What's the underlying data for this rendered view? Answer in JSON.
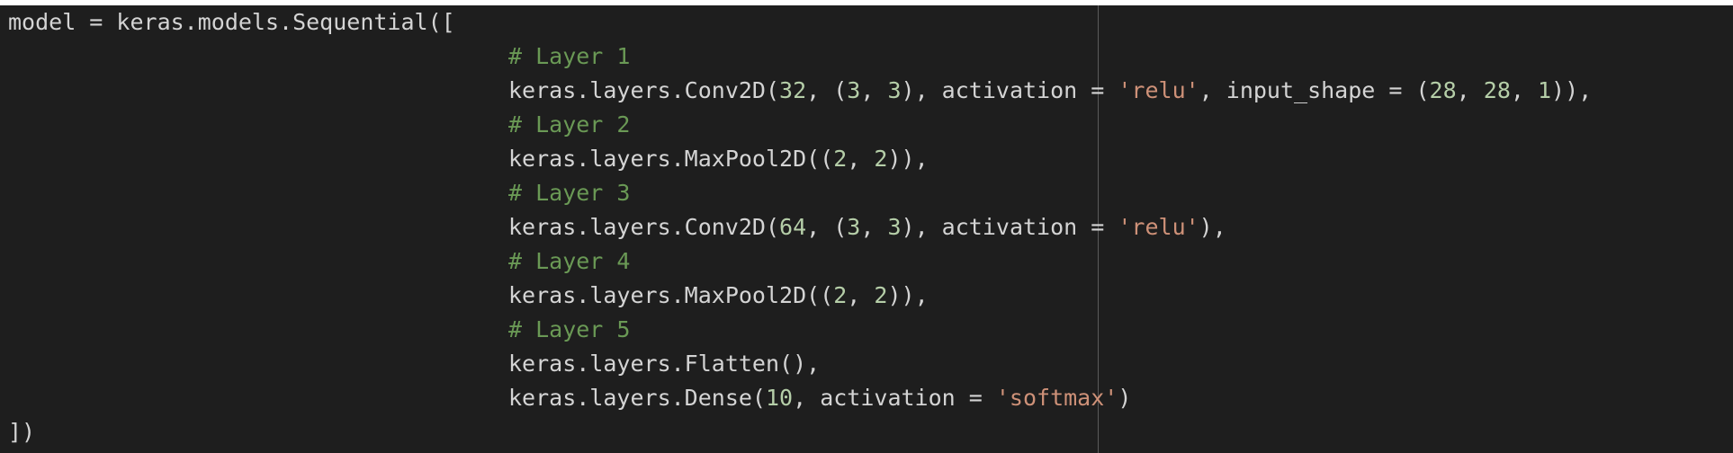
{
  "editor": {
    "colors": {
      "background": "#1e1e1e",
      "text": "#d4d4d4",
      "comment": "#6a9955",
      "string": "#ce9178",
      "number": "#b5cea8",
      "ruler": "#5a5a5a"
    },
    "lines": [
      {
        "tokens": [
          {
            "t": "plain",
            "v": "model = keras.models.Sequential(["
          }
        ]
      },
      {
        "tokens": [
          {
            "t": "comment",
            "v": "# Layer 1"
          }
        ]
      },
      {
        "tokens": [
          {
            "t": "plain",
            "v": "keras.layers.Conv2D("
          },
          {
            "t": "number",
            "v": "32"
          },
          {
            "t": "plain",
            "v": ", ("
          },
          {
            "t": "number",
            "v": "3"
          },
          {
            "t": "plain",
            "v": ", "
          },
          {
            "t": "number",
            "v": "3"
          },
          {
            "t": "plain",
            "v": "), activation = "
          },
          {
            "t": "string",
            "v": "'relu'"
          },
          {
            "t": "plain",
            "v": ", input_shape = ("
          },
          {
            "t": "number",
            "v": "28"
          },
          {
            "t": "plain",
            "v": ", "
          },
          {
            "t": "number",
            "v": "28"
          },
          {
            "t": "plain",
            "v": ", "
          },
          {
            "t": "number",
            "v": "1"
          },
          {
            "t": "plain",
            "v": ")),"
          }
        ]
      },
      {
        "tokens": [
          {
            "t": "comment",
            "v": "# Layer 2"
          }
        ]
      },
      {
        "tokens": [
          {
            "t": "plain",
            "v": "keras.layers.MaxPool2D(("
          },
          {
            "t": "number",
            "v": "2"
          },
          {
            "t": "plain",
            "v": ", "
          },
          {
            "t": "number",
            "v": "2"
          },
          {
            "t": "plain",
            "v": ")),"
          }
        ]
      },
      {
        "tokens": [
          {
            "t": "comment",
            "v": "# Layer 3"
          }
        ]
      },
      {
        "tokens": [
          {
            "t": "plain",
            "v": "keras.layers.Conv2D("
          },
          {
            "t": "number",
            "v": "64"
          },
          {
            "t": "plain",
            "v": ", ("
          },
          {
            "t": "number",
            "v": "3"
          },
          {
            "t": "plain",
            "v": ", "
          },
          {
            "t": "number",
            "v": "3"
          },
          {
            "t": "plain",
            "v": "), activation = "
          },
          {
            "t": "string",
            "v": "'relu'"
          },
          {
            "t": "plain",
            "v": "),"
          }
        ]
      },
      {
        "tokens": [
          {
            "t": "comment",
            "v": "# Layer 4"
          }
        ]
      },
      {
        "tokens": [
          {
            "t": "plain",
            "v": "keras.layers.MaxPool2D(("
          },
          {
            "t": "number",
            "v": "2"
          },
          {
            "t": "plain",
            "v": ", "
          },
          {
            "t": "number",
            "v": "2"
          },
          {
            "t": "plain",
            "v": ")),"
          }
        ]
      },
      {
        "tokens": [
          {
            "t": "comment",
            "v": "# Layer 5"
          }
        ]
      },
      {
        "tokens": [
          {
            "t": "plain",
            "v": "keras.layers.Flatten(),"
          }
        ]
      },
      {
        "tokens": [
          {
            "t": "plain",
            "v": "keras.layers.Dense("
          },
          {
            "t": "number",
            "v": "10"
          },
          {
            "t": "plain",
            "v": ", activation = "
          },
          {
            "t": "string",
            "v": "'softmax'"
          },
          {
            "t": "plain",
            "v": ")"
          }
        ]
      },
      {
        "tokens": [
          {
            "t": "plain",
            "v": "])"
          }
        ]
      }
    ]
  }
}
